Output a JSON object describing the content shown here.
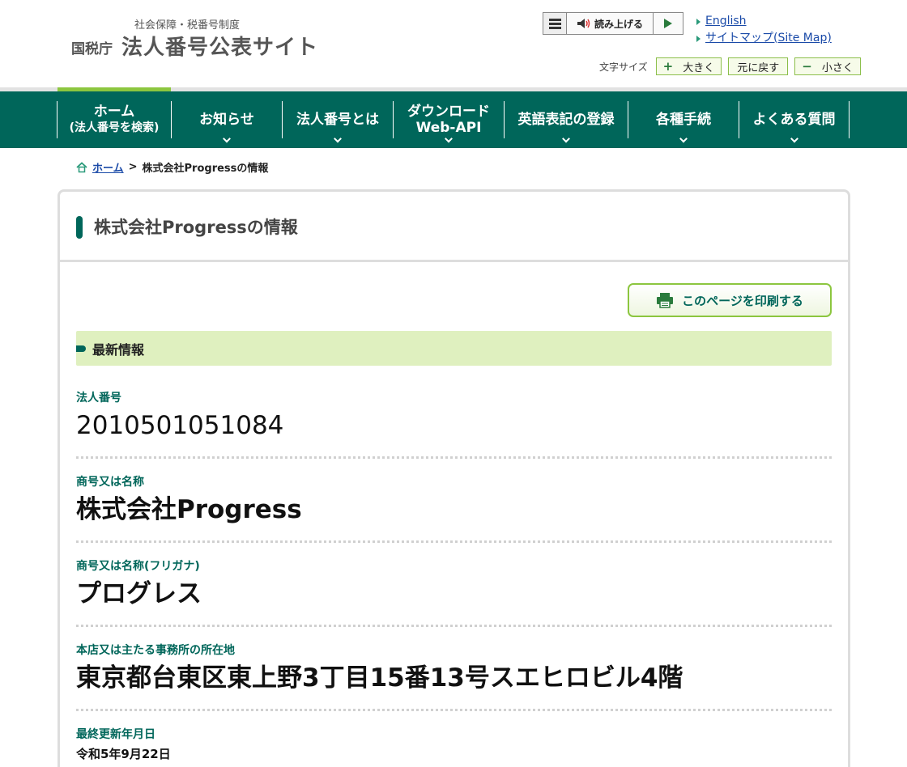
{
  "header": {
    "logo_sub": "社会保障・税番号制度",
    "logo_nta": "国税庁",
    "logo_main": "法人番号公表サイト",
    "read_aloud": "読み上げる",
    "links": [
      "English",
      "サイトマップ(Site Map)"
    ],
    "font_size_label": "文字サイズ",
    "font_buttons": [
      {
        "sign": "+",
        "label": "大きく"
      },
      {
        "sign": "",
        "label": "元に戻す"
      },
      {
        "sign": "−",
        "label": "小さく"
      }
    ]
  },
  "nav": {
    "items": [
      {
        "line1": "ホーム",
        "line2": "(法人番号を検索)"
      },
      {
        "line1": "お知らせ",
        "line2": ""
      },
      {
        "line1": "法人番号とは",
        "line2": ""
      },
      {
        "line1": "ダウンロード",
        "line2": "Web-API"
      },
      {
        "line1": "英語表記の登録",
        "line2": ""
      },
      {
        "line1": "各種手続",
        "line2": ""
      },
      {
        "line1": "よくある質問",
        "line2": ""
      }
    ]
  },
  "breadcrumb": {
    "home": "ホーム",
    "separator": ">",
    "current": "株式会社Progressの情報"
  },
  "page": {
    "title": "株式会社Progressの情報",
    "print_label": "このページを印刷する",
    "section_title": "最新情報",
    "fields": {
      "corp_number_label": "法人番号",
      "corp_number": "2010501051084",
      "name_label": "商号又は名称",
      "name": "株式会社Progress",
      "furigana_label": "商号又は名称(フリガナ)",
      "furigana": "プログレス",
      "address_label": "本店又は主たる事務所の所在地",
      "address": "東京都台東区東上野3丁目15番13号スエヒロビル4階",
      "updated_label": "最終更新年月日",
      "updated": "令和5年9月22日"
    }
  },
  "colors": {
    "brand": "#00665a",
    "accent": "#8cc63f",
    "section_bg": "#dff0bf",
    "link": "#1a4aa8"
  }
}
